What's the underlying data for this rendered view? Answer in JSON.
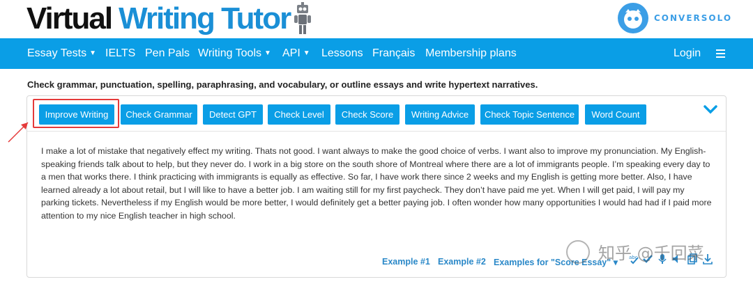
{
  "header": {
    "logo_word1": "Virtual",
    "logo_word2": "Writing Tutor",
    "partner": "CONVERSOLO",
    "accent": "#1a8fd6"
  },
  "nav": {
    "items": [
      {
        "label": "Essay Tests",
        "dropdown": true
      },
      {
        "label": "IELTS",
        "dropdown": false
      },
      {
        "label": "Pen Pals",
        "dropdown": false
      },
      {
        "label": "Writing Tools",
        "dropdown": true
      },
      {
        "label": "API",
        "dropdown": true
      },
      {
        "label": "Lessons",
        "dropdown": false
      },
      {
        "label": "Français",
        "dropdown": false
      },
      {
        "label": "Membership plans",
        "dropdown": false
      }
    ],
    "login": "Login",
    "menu_icon": "hamburger-icon",
    "background": "#0a9ee6"
  },
  "tagline": "Check grammar, punctuation, spelling, paraphrasing, and vocabulary, or outline essays and write hypertext narratives.",
  "toolbar": {
    "buttons": [
      "Improve Writing",
      "Check Grammar",
      "Detect GPT",
      "Check Level",
      "Check Score",
      "Writing Advice",
      "Check Topic Sentence",
      "Word Count"
    ],
    "highlighted": "Improve Writing",
    "expand_icon": "chevron-down-icon"
  },
  "essay": {
    "text": "I make a lot of mistake that negatively effect my writing. Thats not good. I want always to make the good choice of verbs. I want also to improve my pronunciation. My English-speaking friends talk about to help, but they never do. I work in a big store on the south shore of Montreal where there are a lot of immigrants people. I’m speaking every day to a men that works there. I think practicing with immigrants is equally as effective. So far, I have work there since 2 weeks and my English is getting more better. Also, I have learned already a lot about retail, but I will like to have a better job. I am waiting still for my first paycheck. They don’t have paid me yet. When I will get paid, I will pay my parking tickets. Nevertheless if my English would be more better, I would definitely get a better paying job. I often wonder how many opportunities I would had had if I paid more attention to my nice English teacher in high school."
  },
  "examples": {
    "ex1": "Example #1",
    "ex2": "Example #2",
    "ex3": "Examples for \"Score Essay\"",
    "ex3_caret": "▾"
  },
  "watermark": "知乎 @千回菜"
}
